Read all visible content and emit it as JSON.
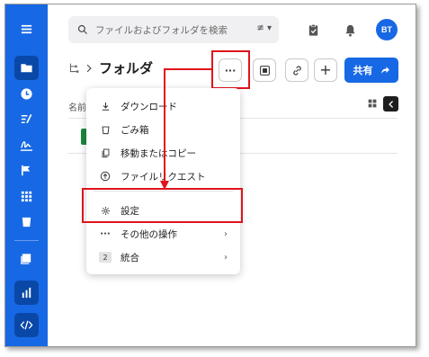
{
  "search": {
    "placeholder": "ファイルおよびフォルダを検索",
    "filter_icon": "≢ ▾"
  },
  "user": {
    "initials": "BT"
  },
  "breadcrumb": {
    "title": "フォルダ"
  },
  "toolbar": {
    "more_label": "···",
    "add_label": "+",
    "share_label": "共有"
  },
  "list": {
    "column_name": "名前"
  },
  "menu": {
    "items": [
      {
        "label": "ダウンロード",
        "icon": "download-icon"
      },
      {
        "label": "ごみ箱",
        "icon": "trash-icon"
      },
      {
        "label": "移動またはコピー",
        "icon": "move-icon"
      },
      {
        "label": "ファイルリクエスト",
        "icon": "upload-icon"
      },
      {
        "label": "設定",
        "icon": "gear-icon"
      },
      {
        "label": "その他の操作",
        "icon": "more-icon",
        "has_submenu": true
      },
      {
        "label": "統合",
        "icon": "badge-2",
        "badge": "2",
        "has_submenu": true
      }
    ]
  },
  "colors": {
    "accent": "#1768e4",
    "highlight": "#e0141c"
  }
}
